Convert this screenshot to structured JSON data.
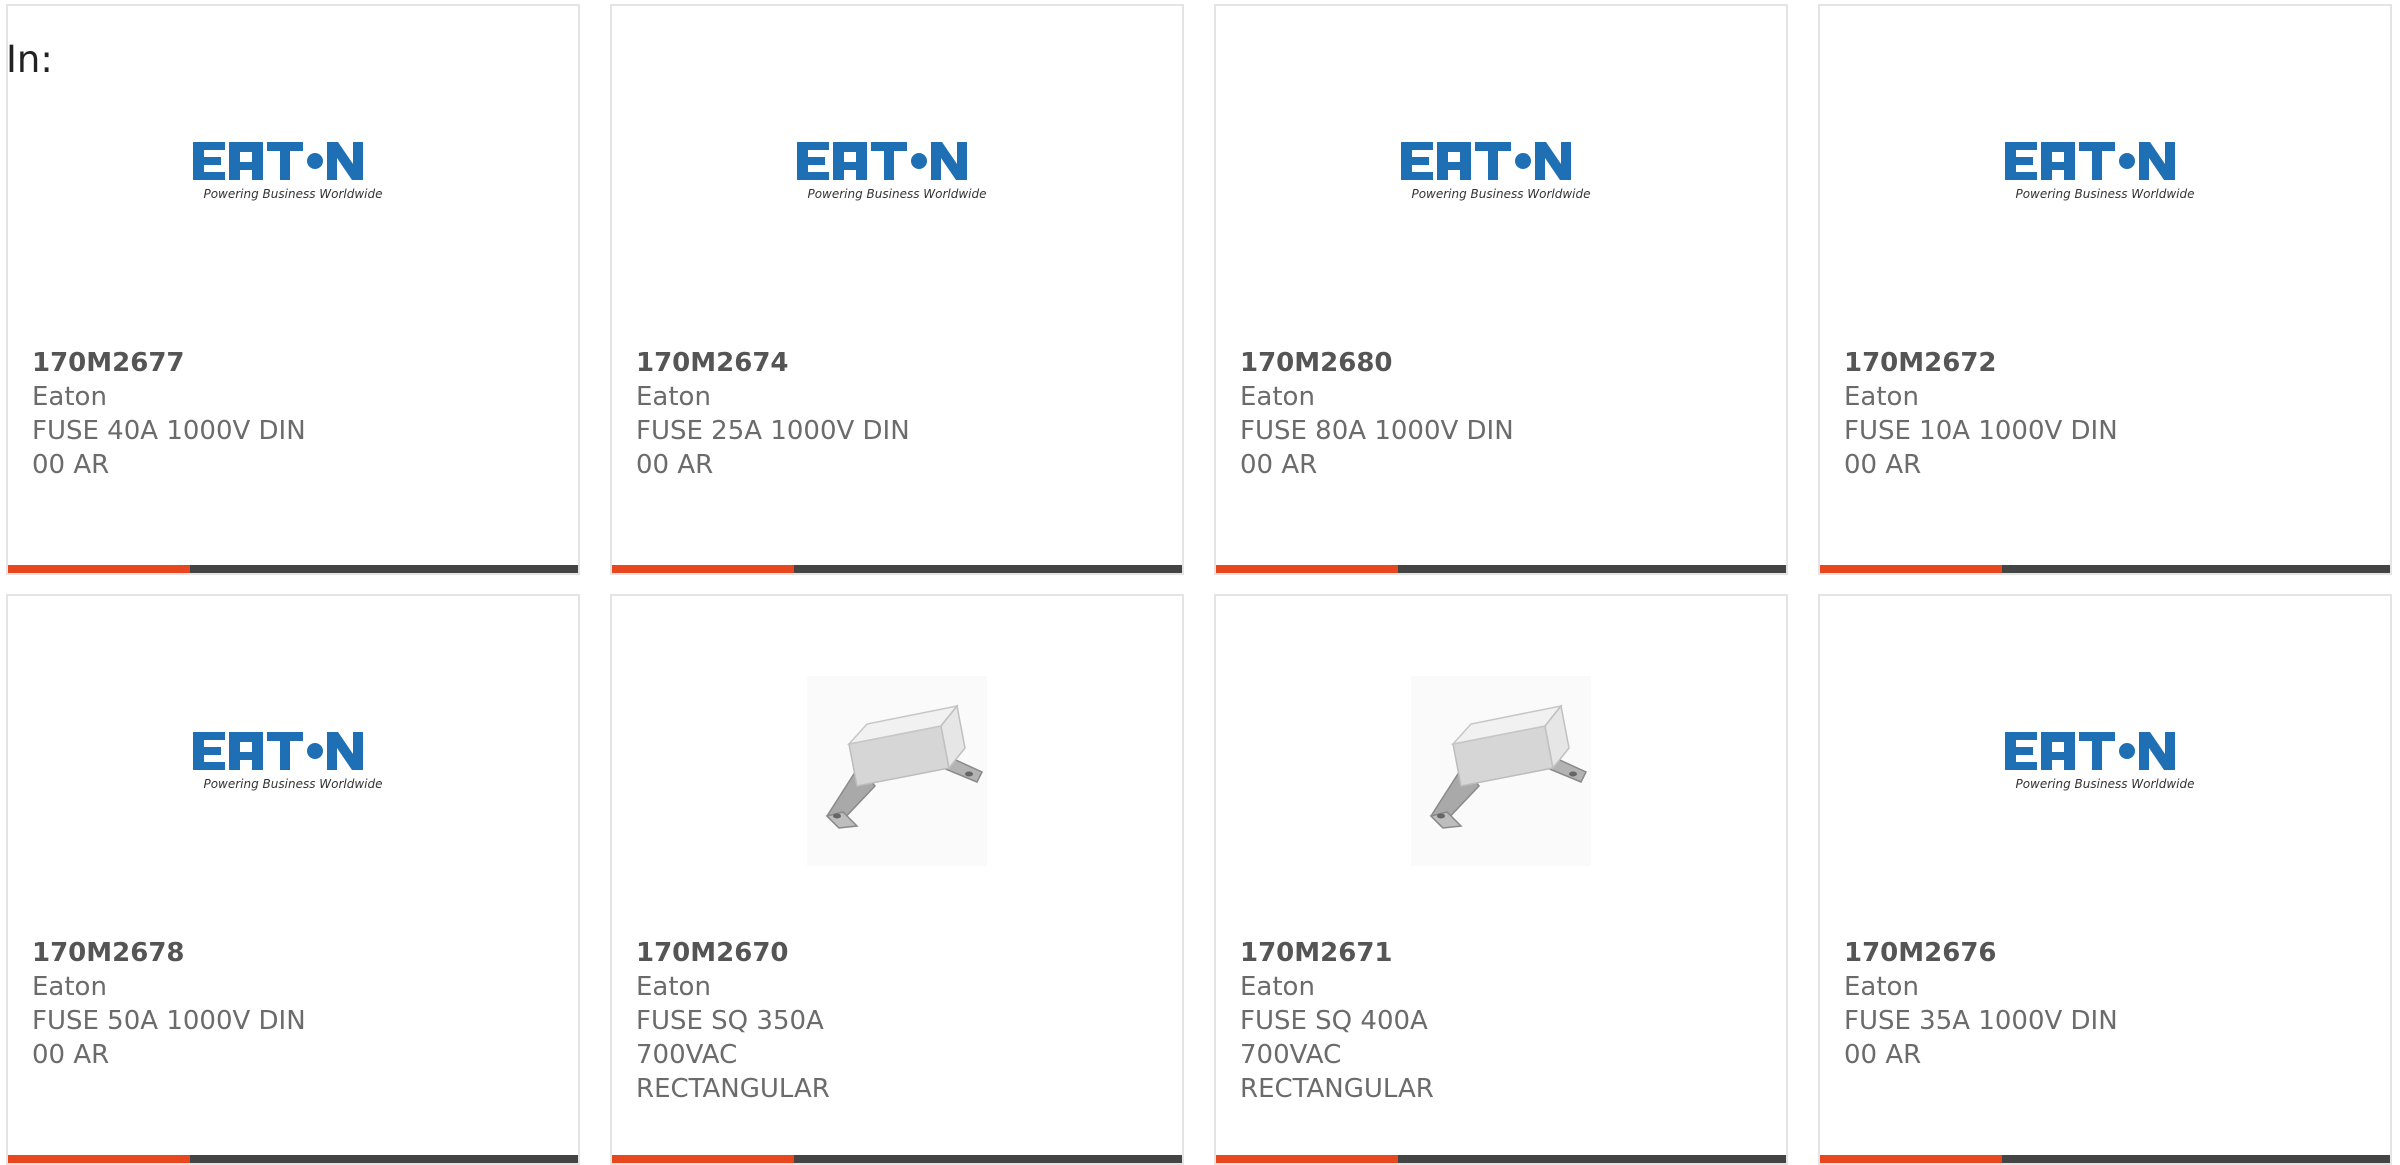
{
  "heading": "In:",
  "logo": {
    "icon": "eaton-logo",
    "wordmark": "EATON",
    "tagline": "Powering Business Worldwide",
    "brand_color": "#1f6fb4"
  },
  "accent_color": "#e8461f",
  "bar_color": "#444444",
  "products": [
    {
      "part": "170M2677",
      "brand": "Eaton",
      "description": "FUSE 40A 1000V DIN 00 AR",
      "image": "eaton-logo"
    },
    {
      "part": "170M2674",
      "brand": "Eaton",
      "description": "FUSE 25A 1000V DIN 00 AR",
      "image": "eaton-logo"
    },
    {
      "part": "170M2680",
      "brand": "Eaton",
      "description": "FUSE 80A 1000V DIN 00 AR",
      "image": "eaton-logo"
    },
    {
      "part": "170M2672",
      "brand": "Eaton",
      "description": "FUSE 10A 1000V DIN 00 AR",
      "image": "eaton-logo"
    },
    {
      "part": "170M2678",
      "brand": "Eaton",
      "description": "FUSE 50A 1000V DIN 00 AR",
      "image": "eaton-logo"
    },
    {
      "part": "170M2670",
      "brand": "Eaton",
      "description": "FUSE SQ 350A 700VAC RECTANGULAR",
      "image": "fuse-photo"
    },
    {
      "part": "170M2671",
      "brand": "Eaton",
      "description": "FUSE SQ 400A 700VAC RECTANGULAR",
      "image": "fuse-photo"
    },
    {
      "part": "170M2676",
      "brand": "Eaton",
      "description": "FUSE 35A 1000V DIN 00 AR",
      "image": "eaton-logo"
    }
  ]
}
